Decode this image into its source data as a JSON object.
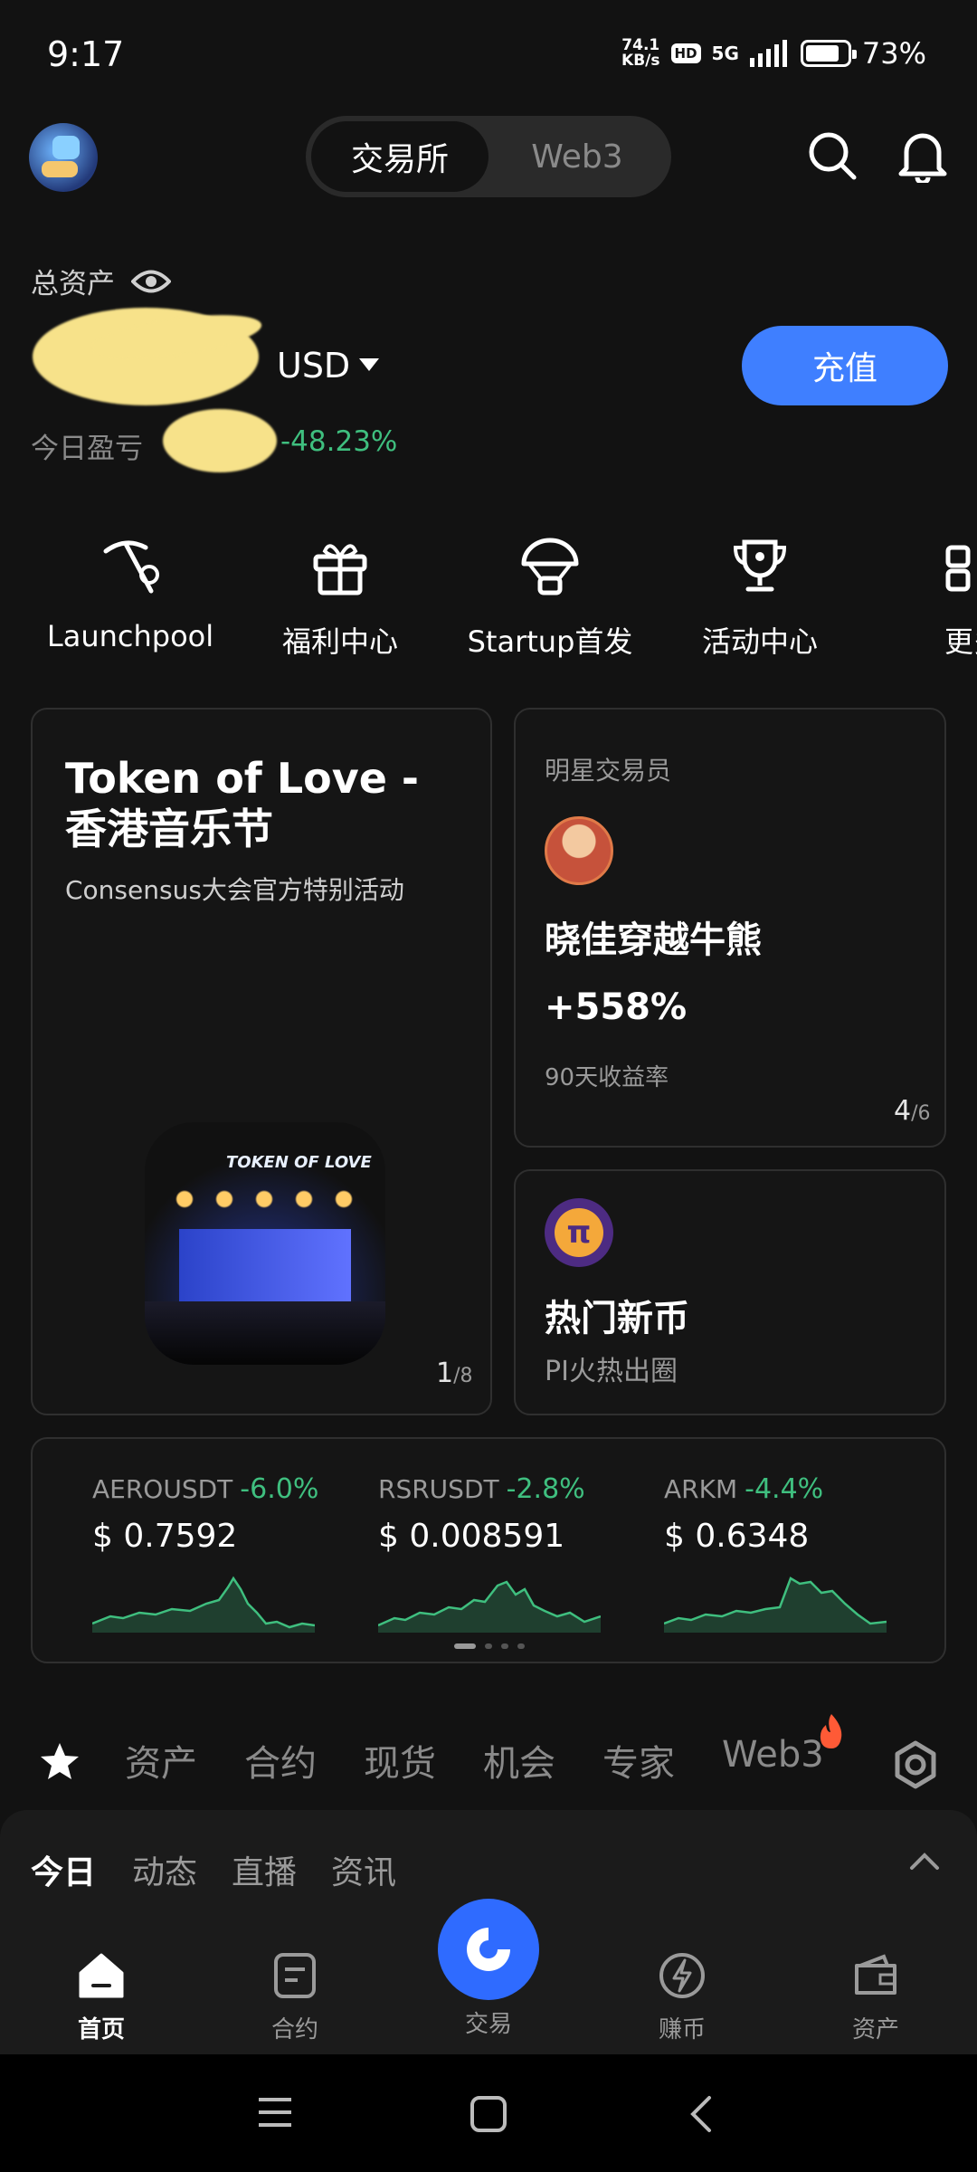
{
  "status_bar": {
    "time": "9:17",
    "net_speed_value": "74.1",
    "net_speed_unit": "KB/s",
    "hd": "HD",
    "network": "5G",
    "battery": "73%"
  },
  "header": {
    "tabs": [
      {
        "label": "交易所",
        "active": true
      },
      {
        "label": "Web3",
        "active": false
      }
    ],
    "icons": [
      "search-icon",
      "bell-icon"
    ]
  },
  "assets": {
    "label": "总资产",
    "currency": "USD",
    "recharge": "充值",
    "pnl_label": "今日盈亏",
    "pnl_percent": "-48.23%"
  },
  "quick_actions": [
    {
      "label": "Launchpool",
      "icon": "pickaxe-icon"
    },
    {
      "label": "福利中心",
      "icon": "gift-icon"
    },
    {
      "label": "Startup首发",
      "icon": "parachute-icon"
    },
    {
      "label": "活动中心",
      "icon": "trophy-icon"
    },
    {
      "label": "更多",
      "icon": "grid-icon"
    }
  ],
  "promo_card": {
    "title": "Token of Love - 香港音乐节",
    "subtitle": "Consensus大会官方特别活动",
    "image_text": "TOKEN OF LOVE",
    "page_current": "1",
    "page_total": "/8"
  },
  "trader_card": {
    "label": "明星交易员",
    "name": "晓佳穿越牛熊",
    "return": "+558%",
    "return_label": "90天收益率",
    "page_current": "4",
    "page_total": "/6"
  },
  "new_coin_card": {
    "title": "热门新币",
    "subtitle": "PI火热出圈",
    "icon_glyph": "π"
  },
  "tickers": [
    {
      "pair": "AEROUSDT",
      "change": "-6.0%",
      "price": "$ 0.7592"
    },
    {
      "pair": "RSRUSDT",
      "change": "-2.8%",
      "price": "$ 0.008591"
    },
    {
      "pair": "ARKM",
      "change": "-4.4%",
      "price": "$ 0.6348"
    }
  ],
  "category_tabs": [
    "资产",
    "合约",
    "现货",
    "机会",
    "专家",
    "Web3"
  ],
  "sub_tabs": [
    {
      "label": "今日",
      "active": true
    },
    {
      "label": "动态",
      "active": false
    },
    {
      "label": "直播",
      "active": false
    },
    {
      "label": "资讯",
      "active": false
    }
  ],
  "bottom_nav": [
    {
      "label": "首页",
      "active": true
    },
    {
      "label": "合约",
      "active": false
    },
    {
      "label": "交易",
      "active": false
    },
    {
      "label": "赚币",
      "active": false
    },
    {
      "label": "资产",
      "active": false
    }
  ],
  "colors": {
    "background": "#121212",
    "accent": "#3f7fff",
    "up_green": "#3fbf7f",
    "fire": "#ff5a36"
  }
}
